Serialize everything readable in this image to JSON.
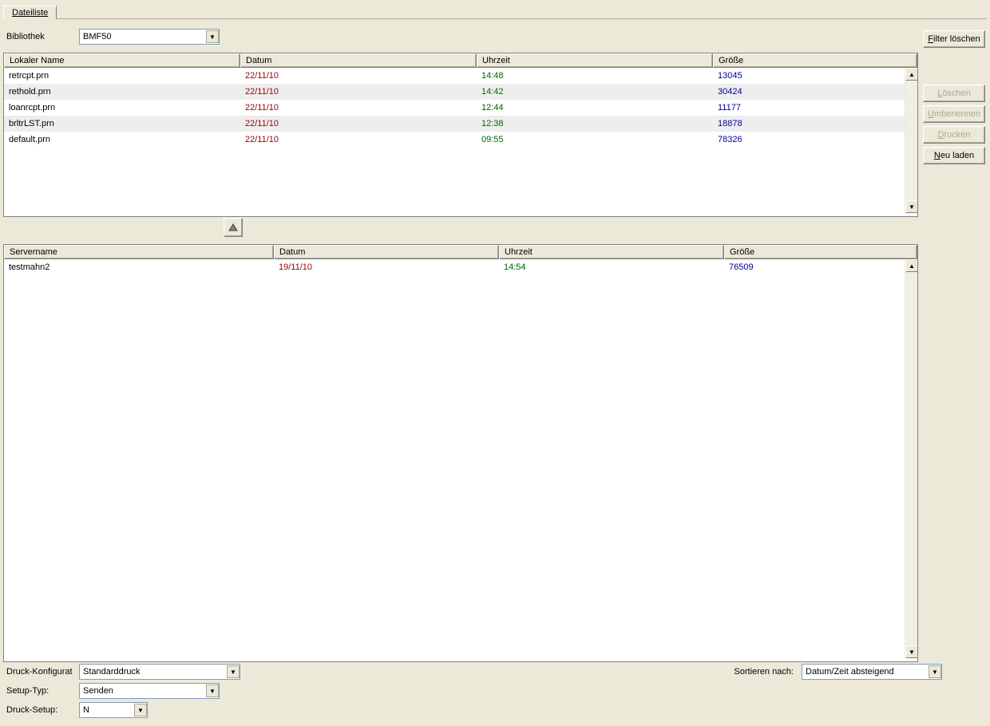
{
  "tab": {
    "label": "Dateiliste"
  },
  "library": {
    "label": "Bibliothek",
    "value": "BMF50"
  },
  "buttons": {
    "filter_clear": "Filter löschen",
    "delete": "Löschen",
    "rename": "Umbenennen",
    "print": "Drucken",
    "reload": "Neu laden"
  },
  "accesskey_prefix": {
    "filter_clear": "F",
    "delete": "L",
    "rename": "U",
    "print": "D",
    "reload": "N"
  },
  "cols_local": {
    "name": "Lokaler Name",
    "date": "Datum",
    "time": "Uhrzeit",
    "size": "Größe"
  },
  "cols_server": {
    "name": "Servername",
    "date": "Datum",
    "time": "Uhrzeit",
    "size": "Größe"
  },
  "col_widths_local": {
    "name": 296,
    "date": 296,
    "time": 296,
    "size": 240
  },
  "col_widths_server": {
    "name": 338,
    "date": 282,
    "time": 282,
    "size": 226
  },
  "local_rows": [
    {
      "name": "retrcpt.prn",
      "date": "22/11/10",
      "time": "14:48",
      "size": "13045"
    },
    {
      "name": "rethold.prn",
      "date": "22/11/10",
      "time": "14:42",
      "size": "30424"
    },
    {
      "name": "loanrcpt.prn",
      "date": "22/11/10",
      "time": "12:44",
      "size": "11177"
    },
    {
      "name": "brltrLST.prn",
      "date": "22/11/10",
      "time": "12:38",
      "size": "18878"
    },
    {
      "name": "default.prn",
      "date": "22/11/10",
      "time": "09:55",
      "size": "78326"
    }
  ],
  "server_rows": [
    {
      "name": "testmahn2",
      "date": "19/11/10",
      "time": "14:54",
      "size": "76509"
    }
  ],
  "bottom": {
    "print_config_label": "Druck-Konfigurat",
    "print_config_value": "Standarddruck",
    "setup_type_label": "Setup-Typ:",
    "setup_type_value": "Senden",
    "setup_label": "Druck-Setup:",
    "setup_value": "N",
    "sort_label": "Sortieren nach:",
    "sort_value": "Datum/Zeit absteigend"
  }
}
